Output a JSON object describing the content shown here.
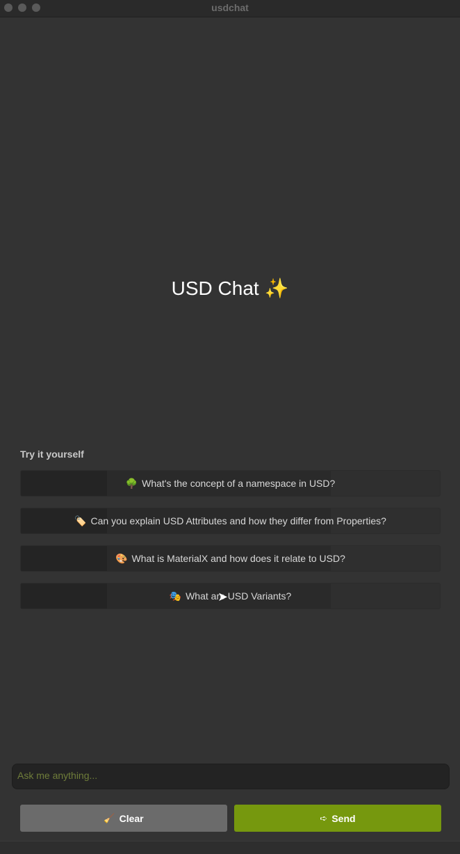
{
  "window": {
    "title": "usdchat"
  },
  "hero": {
    "title": "USD Chat",
    "title_emoji": "✨"
  },
  "suggestions": {
    "label": "Try it yourself",
    "items": [
      {
        "emoji": "🌳",
        "text": "What's the concept of a namespace in USD?"
      },
      {
        "emoji": "🏷️",
        "text": "Can you explain USD Attributes and how they differ from Properties?"
      },
      {
        "emoji": "🎨",
        "text": "What is MaterialX and how does it relate to USD?"
      },
      {
        "emoji": "🎭",
        "text": "What are USD Variants?"
      }
    ]
  },
  "composer": {
    "placeholder": "Ask me anything...",
    "value": ""
  },
  "actions": {
    "clear_icon": "🧹",
    "clear_label": "Clear",
    "send_icon": "➪",
    "send_label": "Send"
  },
  "colors": {
    "background": "#333333",
    "send_accent": "#76980e",
    "clear_button": "#6b6b6b",
    "placeholder": "#6f7d3a"
  },
  "icons": {
    "window_controls": [
      "close-icon",
      "minimize-icon",
      "maximize-icon"
    ],
    "clear": "broom-icon",
    "send": "send-arrow-icon"
  }
}
